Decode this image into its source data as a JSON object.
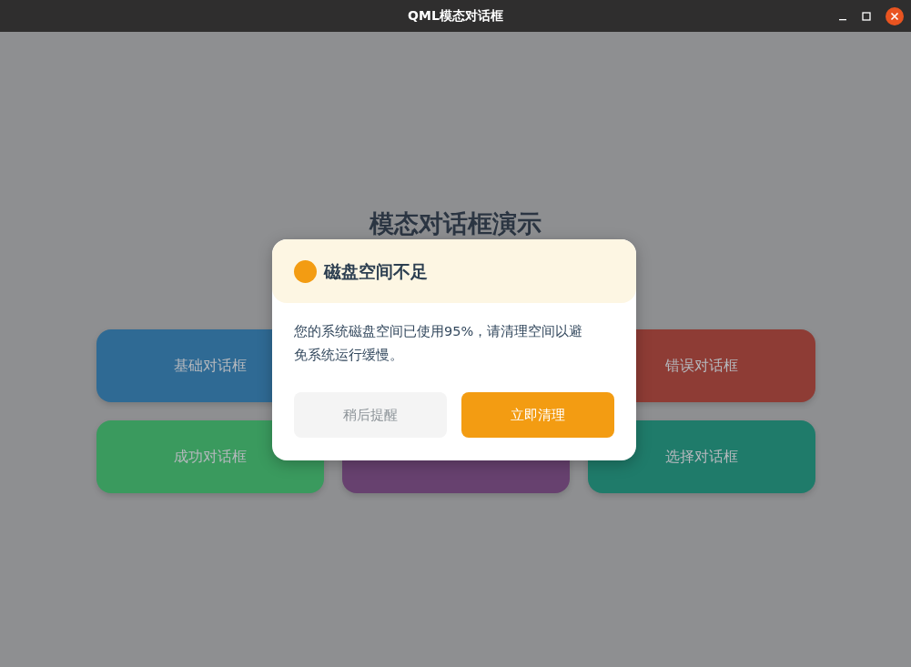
{
  "window": {
    "title": "QML模态对话框"
  },
  "heading": "模态对话框演示",
  "buttons": [
    {
      "label": "基础对话框",
      "color": "#2f6a94"
    },
    {
      "label": "错误对话框",
      "color": "#8e3c35"
    },
    {
      "label": "成功对话框",
      "color": "#3a9a5e"
    },
    {
      "color": "#67416f"
    },
    {
      "label": "选择对话框",
      "color": "#1f7b6a"
    }
  ],
  "dialog": {
    "kind": "warning",
    "title": "磁盘空间不足",
    "message": "您的系统磁盘空间已使用95%，请清理空间以避免系统运行缓慢。",
    "actions": [
      {
        "label": "稍后提醒",
        "kind": "secondary"
      },
      {
        "label": "立即清理",
        "kind": "primary"
      }
    ]
  }
}
